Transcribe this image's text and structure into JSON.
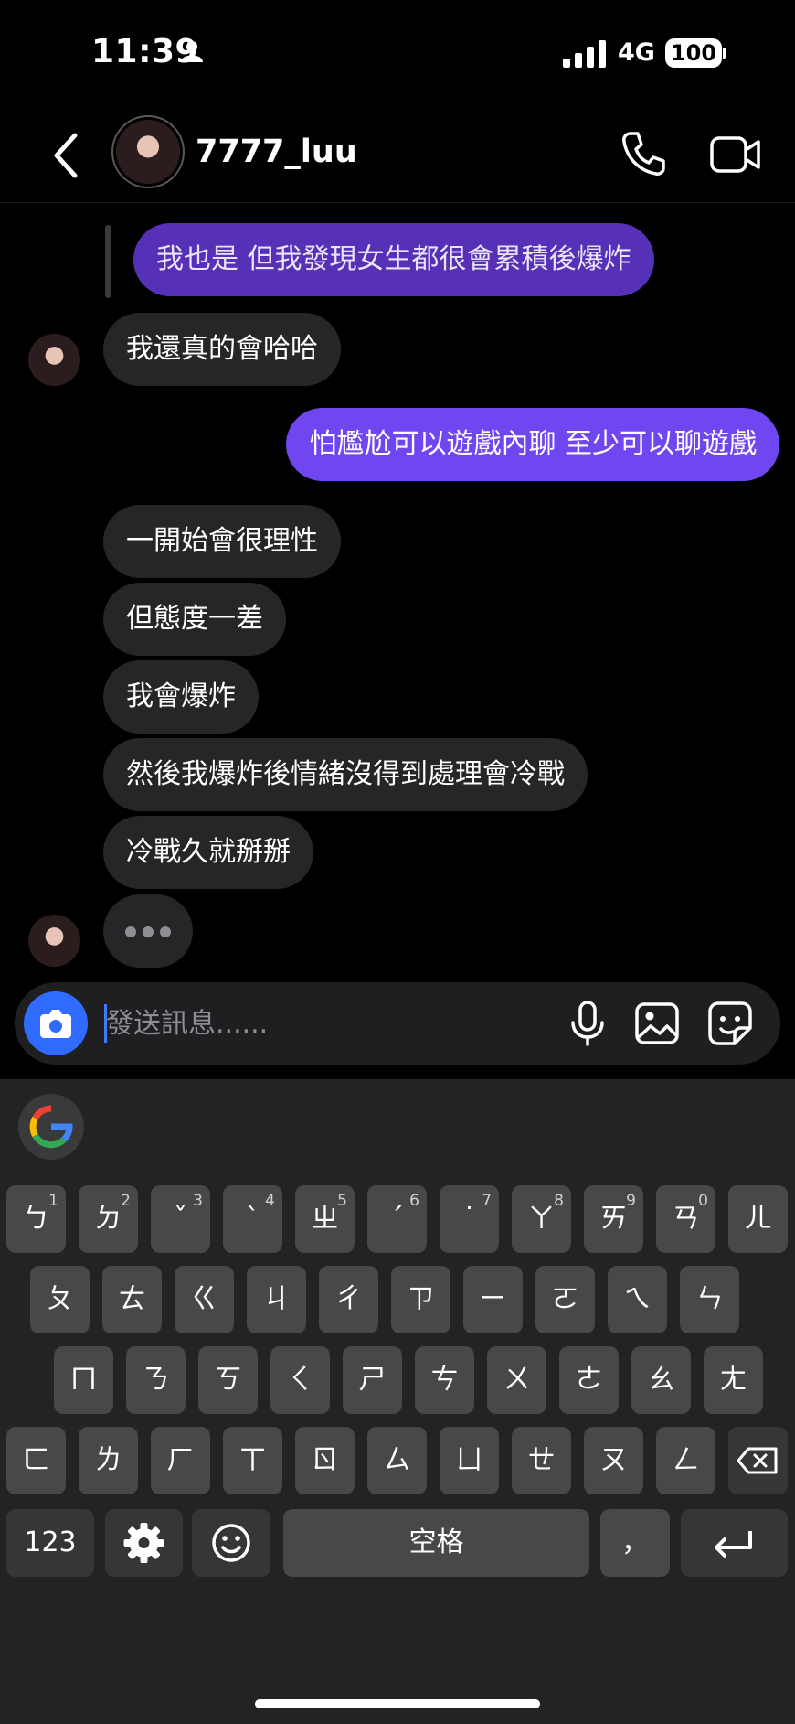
{
  "status_bar": {
    "time": "11:39",
    "network": "4G",
    "battery": "100"
  },
  "header": {
    "username": "7777_luu"
  },
  "messages": [
    {
      "side": "out",
      "text": "我也是 但我發現女生都很會累積後爆炸"
    },
    {
      "side": "in",
      "text": "我還真的會哈哈"
    },
    {
      "side": "out",
      "text": "怕尷尬可以遊戲內聊  至少可以聊遊戲"
    },
    {
      "side": "in",
      "text": "一開始會很理性"
    },
    {
      "side": "in",
      "text": "但態度一差"
    },
    {
      "side": "in",
      "text": "我會爆炸"
    },
    {
      "side": "in",
      "text": "然後我爆炸後情緒沒得到處理會冷戰"
    },
    {
      "side": "in",
      "text": "冷戰久就掰掰"
    }
  ],
  "composer": {
    "placeholder": "發送訊息......"
  },
  "keyboard": {
    "row1": [
      {
        "label": "ㄅ",
        "hint": "1"
      },
      {
        "label": "ㄉ",
        "hint": "2"
      },
      {
        "label": "ˇ",
        "hint": "3"
      },
      {
        "label": "ˋ",
        "hint": "4"
      },
      {
        "label": "ㄓ",
        "hint": "5"
      },
      {
        "label": "ˊ",
        "hint": "6"
      },
      {
        "label": "˙",
        "hint": "7"
      },
      {
        "label": "ㄚ",
        "hint": "8"
      },
      {
        "label": "ㄞ",
        "hint": "9"
      },
      {
        "label": "ㄢ",
        "hint": "0"
      },
      {
        "label": "ㄦ",
        "hint": ""
      }
    ],
    "row2": [
      "ㄆ",
      "ㄊ",
      "ㄍ",
      "ㄐ",
      "ㄔ",
      "ㄗ",
      "ㄧ",
      "ㄛ",
      "ㄟ",
      "ㄣ"
    ],
    "row3": [
      "ㄇ",
      "ㄋ",
      "ㄎ",
      "ㄑ",
      "ㄕ",
      "ㄘ",
      "ㄨ",
      "ㄜ",
      "ㄠ",
      "ㄤ"
    ],
    "row4": [
      "ㄈ",
      "ㄌ",
      "ㄏ",
      "ㄒ",
      "ㄖ",
      "ㄙ",
      "ㄩ",
      "ㄝ",
      "ㄡ",
      "ㄥ"
    ],
    "numbers_label": "123",
    "space_label": "空格",
    "comma_label": "，"
  }
}
